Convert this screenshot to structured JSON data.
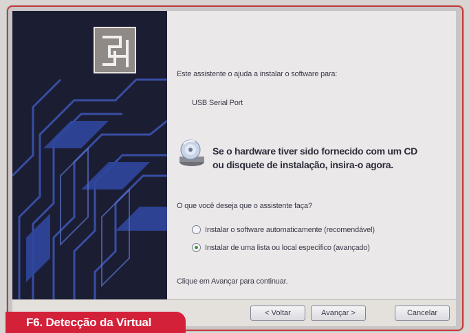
{
  "wizard": {
    "intro": "Este assistente o ajuda a instalar o software para:",
    "device_name": "USB Serial Port",
    "cd_prompt_line1": "Se o hardware tiver sido fornecido com um CD",
    "cd_prompt_line2": "ou disquete de instalação, insira-o agora.",
    "question": "O que você deseja que o assistente faça?",
    "options": [
      {
        "label": "Instalar o software automaticamente (recomendável)",
        "selected": false
      },
      {
        "label": "Instalar de uma lista ou local específico (avançado)",
        "selected": true
      }
    ],
    "hint": "Clique em Avançar para continuar.",
    "buttons": {
      "back": "< Voltar",
      "next": "Avançar >",
      "cancel": "Cancelar"
    },
    "icons": {
      "wizard": "hardware-wizard-icon",
      "cd": "cd-disc-icon"
    }
  },
  "caption": "F6. Detecção da Virtual",
  "colors": {
    "caption_bg": "#d4213a",
    "side_panel_bg": "#1b1d33",
    "side_panel_pattern": "#3e57b8",
    "content_bg": "#eae8e9",
    "window_border": "#c73a3a"
  }
}
